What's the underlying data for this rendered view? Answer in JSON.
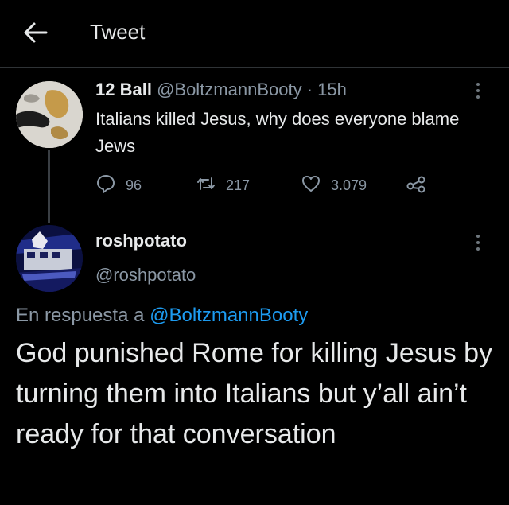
{
  "header": {
    "title": "Tweet"
  },
  "tweet1": {
    "display_name": "12 Ball",
    "handle": "@BoltzmannBooty",
    "separator": "·",
    "time": "15h",
    "text": "Italians killed Jesus, why does everyone blame Jews",
    "replies": "96",
    "retweets": "217",
    "likes": "3.079"
  },
  "tweet2": {
    "display_name": "roshpotato",
    "handle": "@roshpotato",
    "reply_prefix": "En respuesta a",
    "reply_to": "@BoltzmannBooty",
    "text": "God punished Rome for killing Jesus by turning them into Italians but y’all ain’t ready for that conversation"
  },
  "icons": {
    "back": "arrow-left-icon",
    "more": "more-vertical-icon",
    "reply": "reply-bubble-icon",
    "retweet": "retweet-icon",
    "like": "heart-icon",
    "share": "share-icon"
  },
  "colors": {
    "background": "#000000",
    "text": "#e7e9ea",
    "secondary": "#8b98a5",
    "mention": "#1d9bf0"
  }
}
